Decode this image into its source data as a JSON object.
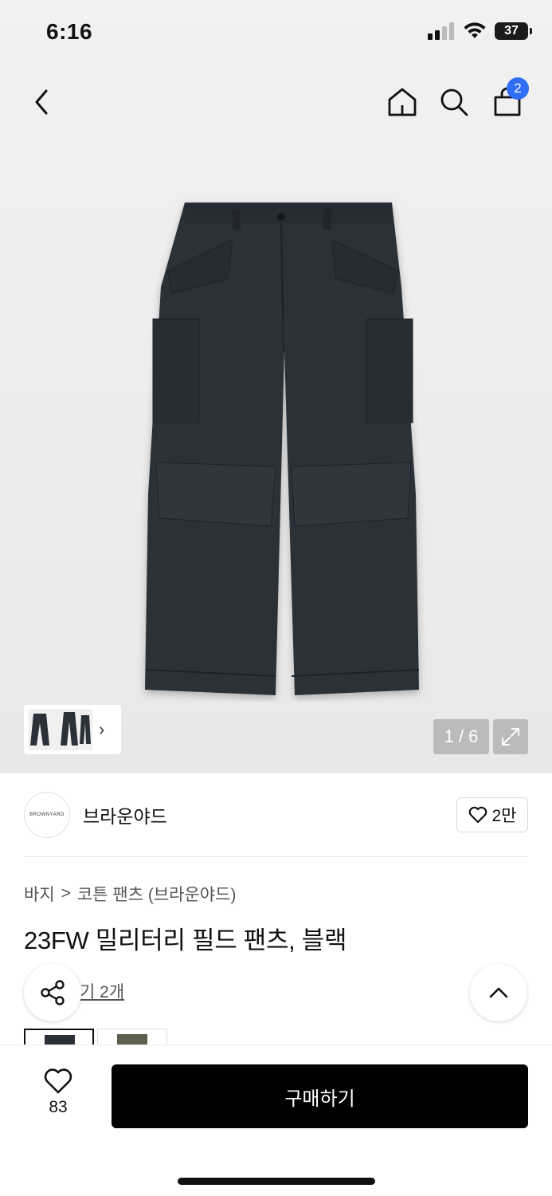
{
  "status_bar": {
    "time": "6:16",
    "battery": "37"
  },
  "nav": {
    "cart_count": "2"
  },
  "gallery": {
    "counter": "1 / 6"
  },
  "brand": {
    "logo_text": "BROWNYARD",
    "name": "브라운야드",
    "likes": "2만"
  },
  "breadcrumb": {
    "category": "바지",
    "separator": ">",
    "subcategory": "코튼 팬츠 (브라운야드)"
  },
  "product": {
    "title": "23FW 밀리터리 필드 팬츠, 블랙",
    "review_text": "기 2개"
  },
  "bottom_bar": {
    "wish_count": "83",
    "buy_label": "구매하기"
  },
  "colors": {
    "accent_badge": "#2f6ef5",
    "buy_button": "#000000",
    "pants": "#2b3138"
  },
  "icons": [
    "back-icon",
    "home-icon",
    "search-icon",
    "bag-icon",
    "expand-icon",
    "heart-icon",
    "share-icon",
    "chevron-up-icon",
    "chevron-right-icon"
  ]
}
